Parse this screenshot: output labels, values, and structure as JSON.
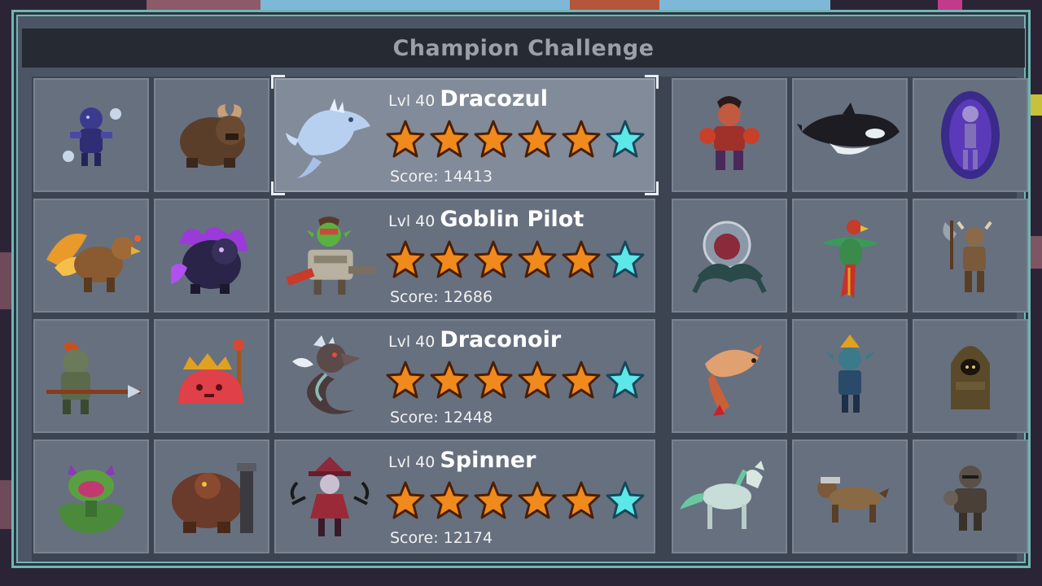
{
  "title": "Champion Challenge",
  "colors": {
    "star_filled": "#f08a1c",
    "star_outline": "#4a1f06",
    "star_bonus": "#5ce8e8",
    "panel_border": "#6fb6b4"
  },
  "left_tiles": [
    {
      "name": "shadow-mage-monster"
    },
    {
      "name": "horned-beast-monster"
    },
    {
      "name": "flame-griffin-monster"
    },
    {
      "name": "purple-flame-beast-monster"
    },
    {
      "name": "fish-spearman-monster"
    },
    {
      "name": "king-slime-monster"
    },
    {
      "name": "carnivorous-plant-monster"
    },
    {
      "name": "cannon-golem-monster"
    }
  ],
  "right_tiles": [
    {
      "name": "fire-brawler-monster"
    },
    {
      "name": "orca-monster"
    },
    {
      "name": "void-skeleton-monster"
    },
    {
      "name": "brain-jelly-monster"
    },
    {
      "name": "parrot-monster"
    },
    {
      "name": "minotaur-axe-monster"
    },
    {
      "name": "fox-spirit-monster"
    },
    {
      "name": "goblin-mage-monster"
    },
    {
      "name": "hooded-monk-monster"
    },
    {
      "name": "spectral-horse-monster"
    },
    {
      "name": "hound-monster"
    },
    {
      "name": "armored-knight-monster"
    }
  ],
  "entries": [
    {
      "level": "Lvl 40",
      "name": "Dracozul",
      "score": "Score: 14413",
      "stars_filled": 5,
      "stars_bonus": 1,
      "selected": true
    },
    {
      "level": "Lvl 40",
      "name": "Goblin Pilot",
      "score": "Score: 12686",
      "stars_filled": 5,
      "stars_bonus": 1,
      "selected": false
    },
    {
      "level": "Lvl 40",
      "name": "Draconoir",
      "score": "Score: 12448",
      "stars_filled": 5,
      "stars_bonus": 1,
      "selected": false
    },
    {
      "level": "Lvl 40",
      "name": "Spinner",
      "score": "Score: 12174",
      "stars_filled": 5,
      "stars_bonus": 1,
      "selected": false
    }
  ]
}
